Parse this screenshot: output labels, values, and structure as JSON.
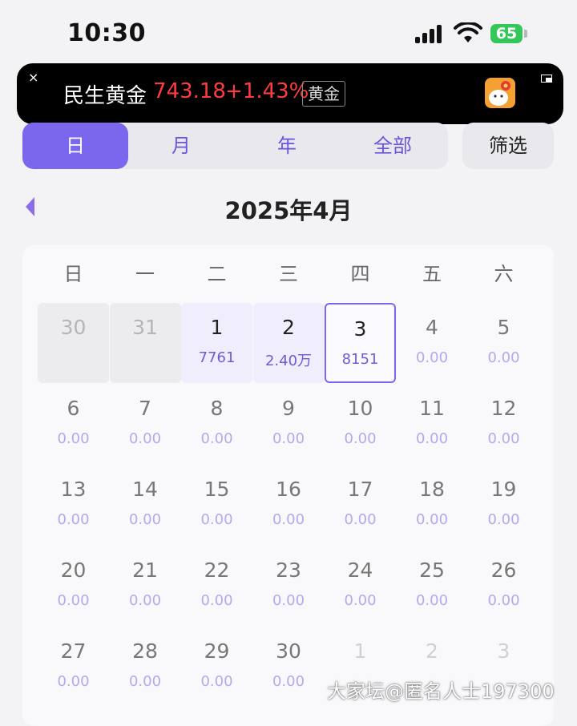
{
  "status_bar": {
    "time": "10:30",
    "battery": "65"
  },
  "banner": {
    "close": "×",
    "name": "民生黄金",
    "price": "743.18",
    "change": "+1.43%",
    "tag": "黄金"
  },
  "tabs": [
    {
      "label": "日",
      "active": true
    },
    {
      "label": "月",
      "active": false
    },
    {
      "label": "年",
      "active": false
    },
    {
      "label": "全部",
      "active": false
    }
  ],
  "filter_label": "筛选",
  "month_title": "2025年4月",
  "weekdays": [
    "日",
    "一",
    "二",
    "三",
    "四",
    "五",
    "六"
  ],
  "weeks": [
    [
      {
        "day": "30",
        "amount": "",
        "state": "other"
      },
      {
        "day": "31",
        "amount": "",
        "state": "other"
      },
      {
        "day": "1",
        "amount": "7761",
        "state": "has"
      },
      {
        "day": "2",
        "amount": "2.40万",
        "state": "has"
      },
      {
        "day": "3",
        "amount": "8151",
        "state": "selected"
      },
      {
        "day": "4",
        "amount": "0.00",
        "state": "normal"
      },
      {
        "day": "5",
        "amount": "0.00",
        "state": "normal"
      }
    ],
    [
      {
        "day": "6",
        "amount": "0.00",
        "state": "normal"
      },
      {
        "day": "7",
        "amount": "0.00",
        "state": "normal"
      },
      {
        "day": "8",
        "amount": "0.00",
        "state": "normal"
      },
      {
        "day": "9",
        "amount": "0.00",
        "state": "normal"
      },
      {
        "day": "10",
        "amount": "0.00",
        "state": "normal"
      },
      {
        "day": "11",
        "amount": "0.00",
        "state": "normal"
      },
      {
        "day": "12",
        "amount": "0.00",
        "state": "normal"
      }
    ],
    [
      {
        "day": "13",
        "amount": "0.00",
        "state": "normal"
      },
      {
        "day": "14",
        "amount": "0.00",
        "state": "normal"
      },
      {
        "day": "15",
        "amount": "0.00",
        "state": "normal"
      },
      {
        "day": "16",
        "amount": "0.00",
        "state": "normal"
      },
      {
        "day": "17",
        "amount": "0.00",
        "state": "normal"
      },
      {
        "day": "18",
        "amount": "0.00",
        "state": "normal"
      },
      {
        "day": "19",
        "amount": "0.00",
        "state": "normal"
      }
    ],
    [
      {
        "day": "20",
        "amount": "0.00",
        "state": "normal"
      },
      {
        "day": "21",
        "amount": "0.00",
        "state": "normal"
      },
      {
        "day": "22",
        "amount": "0.00",
        "state": "normal"
      },
      {
        "day": "23",
        "amount": "0.00",
        "state": "normal"
      },
      {
        "day": "24",
        "amount": "0.00",
        "state": "normal"
      },
      {
        "day": "25",
        "amount": "0.00",
        "state": "normal"
      },
      {
        "day": "26",
        "amount": "0.00",
        "state": "normal"
      }
    ],
    [
      {
        "day": "27",
        "amount": "0.00",
        "state": "normal"
      },
      {
        "day": "28",
        "amount": "0.00",
        "state": "normal"
      },
      {
        "day": "29",
        "amount": "0.00",
        "state": "normal"
      },
      {
        "day": "30",
        "amount": "0.00",
        "state": "normal"
      },
      {
        "day": "1",
        "amount": "",
        "state": "other-light"
      },
      {
        "day": "2",
        "amount": "",
        "state": "other-light"
      },
      {
        "day": "3",
        "amount": "",
        "state": "other-light"
      }
    ]
  ],
  "watermark": "大家坛@匿名人士197300",
  "colors": {
    "accent": "#7b67ee",
    "up_red": "#ff3b3b",
    "battery_green": "#34c759"
  },
  "icons": [
    "signal-icon",
    "wifi-icon",
    "battery-icon",
    "close-icon",
    "app-icon",
    "expand-icon",
    "chevron-left-icon"
  ]
}
